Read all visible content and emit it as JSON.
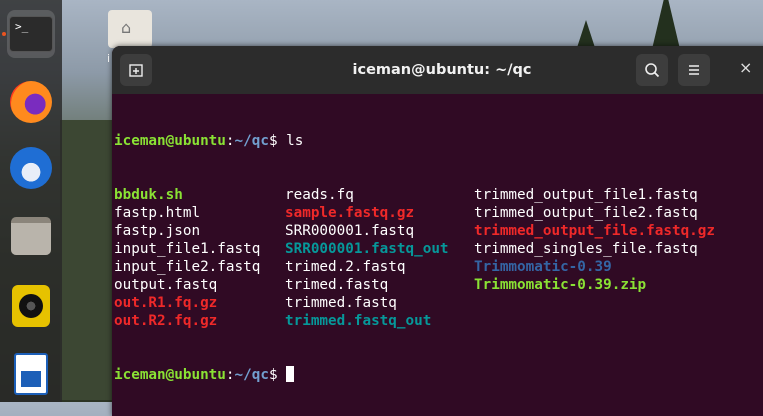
{
  "desktop": {
    "home_folder_label": "i"
  },
  "dock": {
    "items": [
      {
        "name": "terminal",
        "icon": "terminal-icon",
        "glyph": ">_",
        "active": true
      },
      {
        "name": "firefox",
        "icon": "firefox-icon"
      },
      {
        "name": "thunderbird",
        "icon": "thunderbird-icon"
      },
      {
        "name": "files",
        "icon": "files-icon"
      },
      {
        "name": "rhythmbox",
        "icon": "speaker-icon"
      },
      {
        "name": "libreoffice-writer",
        "icon": "document-icon"
      }
    ]
  },
  "window": {
    "title": "iceman@ubuntu: ~/qc",
    "new_tab_icon": "new-tab-icon",
    "search_icon": "search-icon",
    "menu_icon": "hamburger-menu-icon",
    "close_glyph": "×"
  },
  "terminal": {
    "prompt_user": "iceman@ubuntu",
    "prompt_sep": ":",
    "prompt_path": "~/qc",
    "prompt_symbol": "$ ",
    "command": "ls",
    "rows": [
      [
        {
          "text": "bbduk.sh",
          "style": "exe"
        },
        {
          "text": "reads.fq",
          "style": "plain"
        },
        {
          "text": "trimmed_output_file1.fastq",
          "style": "plain"
        }
      ],
      [
        {
          "text": "fastp.html",
          "style": "plain"
        },
        {
          "text": "sample.fastq.gz",
          "style": "arc"
        },
        {
          "text": "trimmed_output_file2.fastq",
          "style": "plain"
        }
      ],
      [
        {
          "text": "fastp.json",
          "style": "plain"
        },
        {
          "text": "SRR000001.fastq",
          "style": "plain"
        },
        {
          "text": "trimmed_output_file.fastq.gz",
          "style": "arc"
        }
      ],
      [
        {
          "text": "input_file1.fastq",
          "style": "plain"
        },
        {
          "text": "SRR000001.fastq_out",
          "style": "cyan"
        },
        {
          "text": "trimmed_singles_file.fastq",
          "style": "plain"
        }
      ],
      [
        {
          "text": "input_file2.fastq",
          "style": "plain"
        },
        {
          "text": "trimed.2.fastq",
          "style": "plain"
        },
        {
          "text": "Trimmomatic-0.39",
          "style": "dir"
        }
      ],
      [
        {
          "text": "output.fastq",
          "style": "plain"
        },
        {
          "text": "trimed.fastq",
          "style": "plain"
        },
        {
          "text": "Trimmomatic-0.39.zip",
          "style": "exe"
        }
      ],
      [
        {
          "text": "out.R1.fq.gz",
          "style": "arc"
        },
        {
          "text": "trimmed.fastq",
          "style": "plain"
        },
        {
          "text": "",
          "style": "plain"
        }
      ],
      [
        {
          "text": "out.R2.fq.gz",
          "style": "arc"
        },
        {
          "text": "trimmed.fastq_out",
          "style": "cyan"
        },
        {
          "text": "",
          "style": "plain"
        }
      ]
    ]
  }
}
